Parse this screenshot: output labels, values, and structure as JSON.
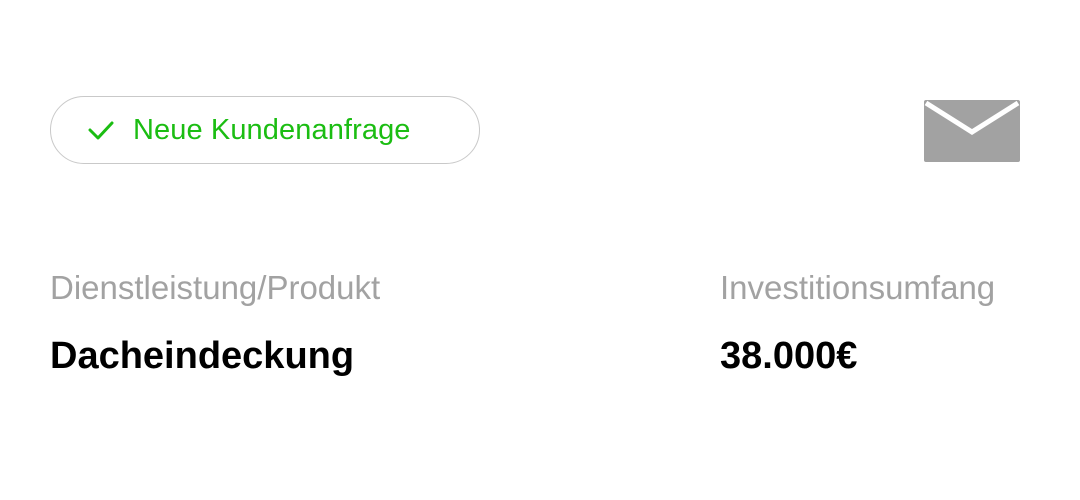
{
  "status": {
    "label": "Neue Kundenanfrage",
    "icon": "check-icon",
    "color": "#1bbd12"
  },
  "actions": {
    "mail_icon": "envelope-icon",
    "mail_icon_color": "#a2a2a2"
  },
  "fields": {
    "service": {
      "label": "Dienstleistung/Produkt",
      "value": "Dacheindeckung"
    },
    "investment": {
      "label": "Investitionsumfang",
      "value": "38.000€"
    }
  }
}
